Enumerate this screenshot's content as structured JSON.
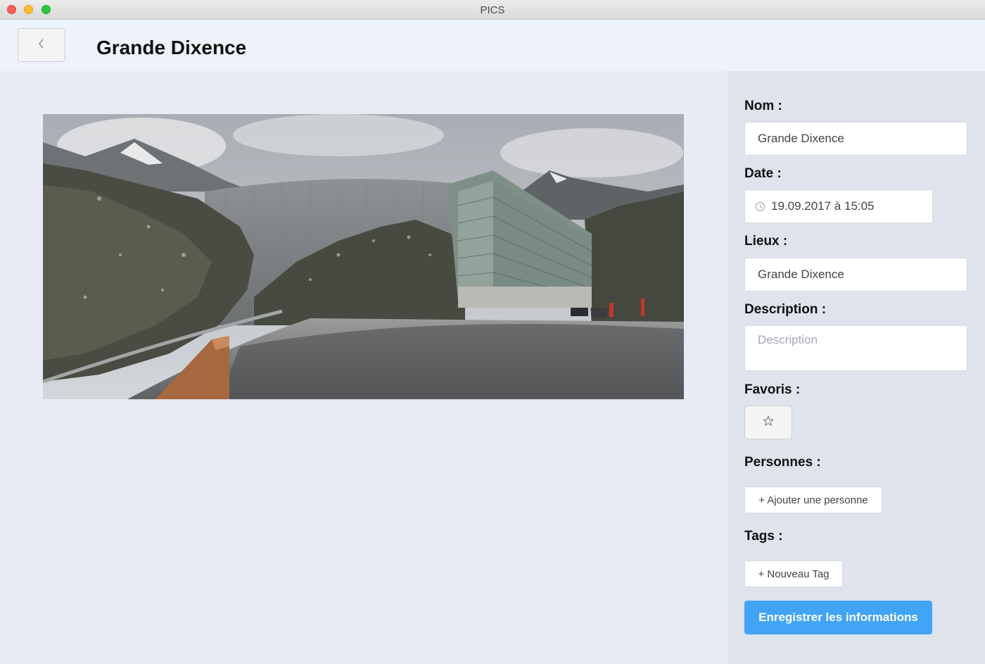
{
  "window": {
    "title": "PICS"
  },
  "header": {
    "title": "Grande Dixence"
  },
  "form": {
    "name_label": "Nom :",
    "name_value": "Grande Dixence",
    "date_label": "Date :",
    "date_value": "19.09.2017 à 15:05",
    "place_label": "Lieux :",
    "place_value": "Grande Dixence",
    "description_label": "Description :",
    "description_placeholder": "Description",
    "favorites_label": "Favoris :",
    "persons_label": "Personnes :",
    "add_person_label": "+ Ajouter une personne",
    "tags_label": "Tags :",
    "new_tag_label": "+ Nouveau Tag",
    "save_label": "Enregistrer les informations"
  },
  "icons": {
    "back": "chevron-left-icon",
    "clock": "clock-icon",
    "favorite": "star-outline-icon"
  },
  "colors": {
    "accent": "#41a4f5"
  }
}
